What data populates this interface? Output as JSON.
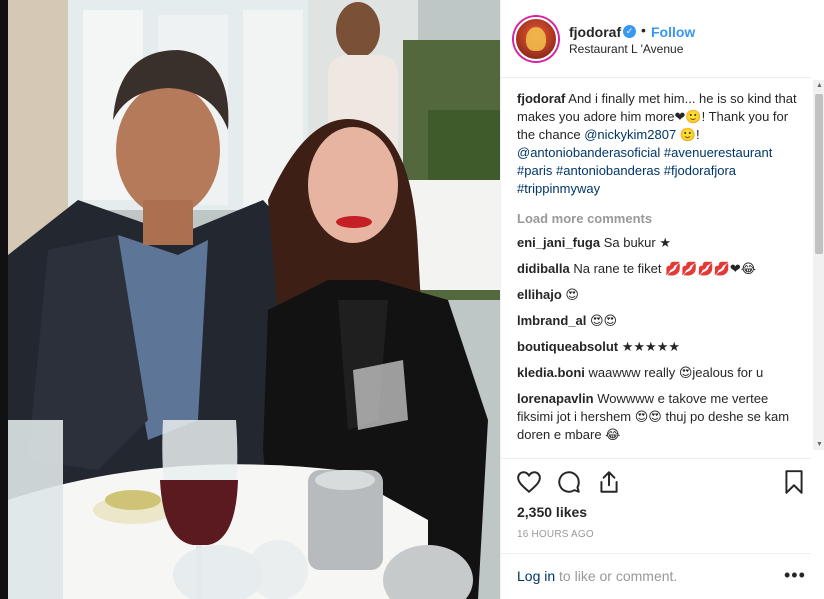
{
  "post": {
    "username": "fjodoraf",
    "follow_label": "Follow",
    "location": "Restaurant L 'Avenue",
    "separator": "•",
    "verified_mark": "✓"
  },
  "caption": {
    "username": "fjodoraf",
    "text_1": " And i finally met him... he is so kind that makes you adore him more",
    "emoji_1": "❤🙂",
    "text_2": "! Thank you for the chance ",
    "mention_1": "@nickykim2807",
    "text_3": " 🙂! ",
    "mention_2": "@antoniobanderasoficial",
    "hashtags": [
      "#avenuerestaurant",
      "#paris",
      "#antoniobanderas",
      "#fjodorafjora",
      "#trippinmyway"
    ]
  },
  "load_more_label": "Load more comments",
  "comments": [
    {
      "user": "eni_jani_fuga",
      "text": "Sa bukur ★"
    },
    {
      "user": "didiballa",
      "text": "Na rane te fiket 💋💋💋💋❤😂"
    },
    {
      "user": "ellihajo",
      "text": "😍"
    },
    {
      "user": "lmbrand_al",
      "text": "😍😍"
    },
    {
      "user": "boutiqueabsolut",
      "text": "★★★★★"
    },
    {
      "user": "kledia.boni",
      "text": "waawww really 😍jealous for u"
    },
    {
      "user": "lorenapavlin",
      "text": "Wowwww e takove me vertee fiksimi jot i hershem 😍😍 thuj po deshe se kam doren e mbare 😂"
    }
  ],
  "likes_label": "2,350 likes",
  "time_label": "16 HOURS AGO",
  "footer": {
    "login_link": "Log in",
    "login_text": " to like or comment.",
    "more_label": "•••"
  },
  "icons": {
    "like": "heart-icon",
    "comment": "comment-icon",
    "share": "share-icon",
    "save": "bookmark-icon"
  },
  "colors": {
    "link": "#003569",
    "follow": "#3897f0",
    "muted": "#999999"
  }
}
